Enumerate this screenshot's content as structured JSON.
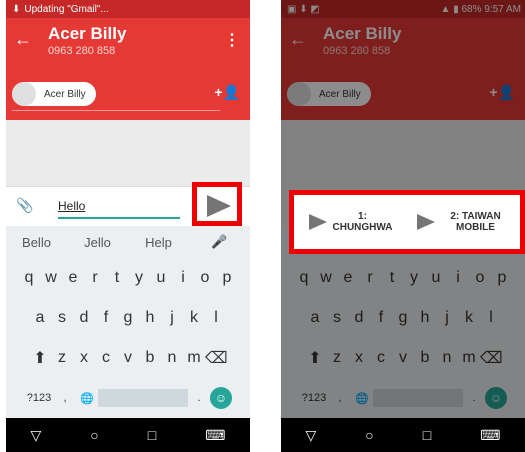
{
  "left": {
    "status_text": "Updating \"Gmail\"...",
    "contact_name": "Acer Billy",
    "phone": "0963 280 858",
    "chip_label": "Acer Billy",
    "message": "Hello",
    "suggestions": [
      "Bello",
      "Jello",
      "Help"
    ]
  },
  "right": {
    "status_text": "9:57 AM",
    "battery": "68%",
    "contact_name": "Acer Billy",
    "phone": "0963 280 858",
    "chip_label": "Acer Billy",
    "sim1": "1: CHUNGHWA",
    "sim2": "2: TAIWAN MOBILE"
  },
  "keyboard": {
    "row1": [
      "q",
      "w",
      "e",
      "r",
      "t",
      "y",
      "u",
      "i",
      "o",
      "p"
    ],
    "row2": [
      "a",
      "s",
      "d",
      "f",
      "g",
      "h",
      "j",
      "k",
      "l"
    ],
    "row3": [
      "z",
      "x",
      "c",
      "v",
      "b",
      "n",
      "m"
    ],
    "symbols": "?123",
    "comma": ",",
    "period": "."
  },
  "colors": {
    "brand": "#e53935",
    "accent": "#26a69a",
    "highlight": "#ff0000"
  }
}
